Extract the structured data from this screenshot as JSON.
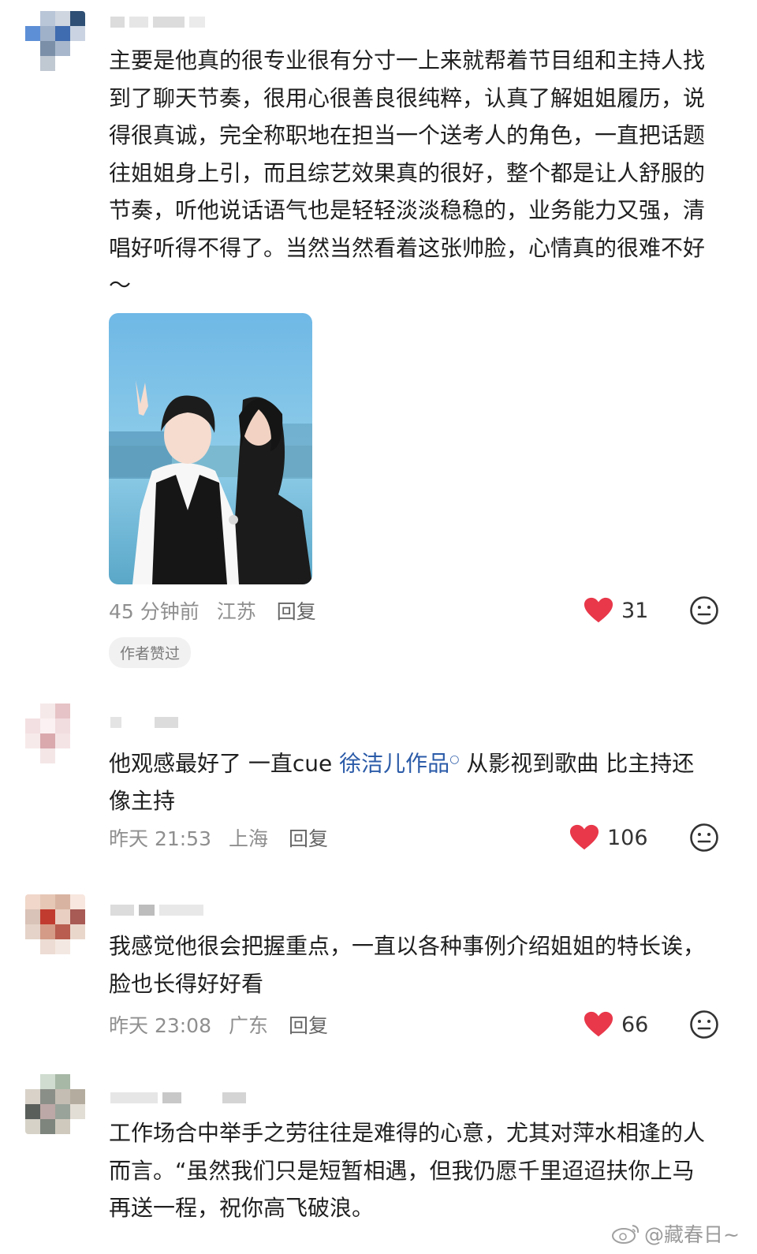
{
  "comments": [
    {
      "text": "主要是他真的很专业很有分寸一上来就帮着节目组和主持人找到了聊天节奏，很用心很善良很纯粹，认真了解姐姐履历，说得很真诚，完全称职地在担当一个送考人的角色，一直把话题往姐姐身上引，而且综艺效果真的很好，整个都是让人舒服的节奏，听他说话语气也是轻轻淡淡稳稳的，业务能力又强，清唱好听得不得了。当然当然看着这张帅脸，心情真的很难不好～",
      "time": "45 分钟前",
      "location": "江苏",
      "reply_label": "回复",
      "likes": "31",
      "badge": "作者赞过"
    },
    {
      "text_before": "他观感最好了 一直cue ",
      "tag": "徐洁儿作品",
      "text_after": " 从影视到歌曲 比主持还像主持",
      "time": "昨天 21:53",
      "location": "上海",
      "reply_label": "回复",
      "likes": "106"
    },
    {
      "text": "我感觉他很会把握重点，一直以各种事例介绍姐姐的特长诶，脸也长得好好看",
      "time": "昨天 23:08",
      "location": "广东",
      "reply_label": "回复",
      "likes": "66"
    },
    {
      "text": "工作场合中举手之劳往往是难得的心意，尤其对萍水相逢的人而言。“虽然我们只是短暂相遇，但我仍愿千里迢迢扶你上马再送一程，祝你高飞破浪。"
    }
  ],
  "watermark": "@藏春日~",
  "icons": {
    "like": "heart-icon",
    "dislike": "neutral-face-icon",
    "search": "search-icon",
    "weibo": "weibo-logo"
  },
  "colors": {
    "heart": "#e8384a",
    "link": "#2b5ba8",
    "meta": "#8f8f8f"
  }
}
